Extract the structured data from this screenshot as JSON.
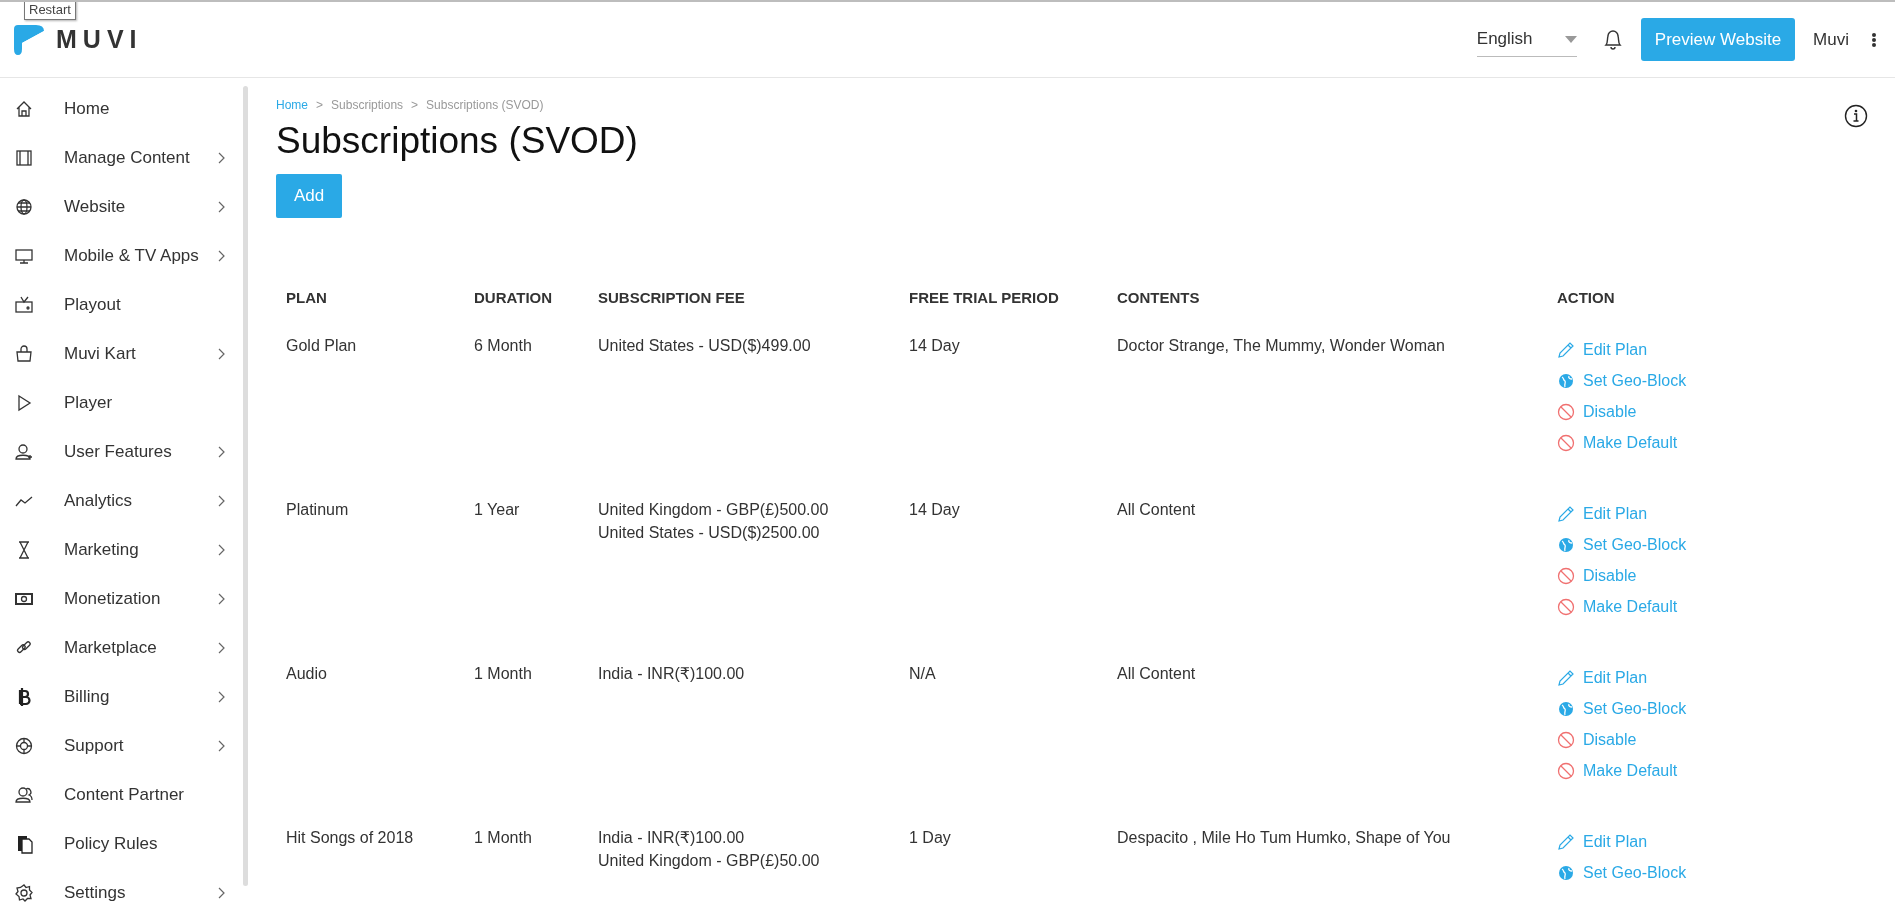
{
  "tooltip": "Restart",
  "logo": {
    "text": "MUVI"
  },
  "header": {
    "language": {
      "value": "English"
    },
    "preview_button": "Preview Website",
    "user": "Muvi"
  },
  "sidebar": {
    "items": [
      {
        "label": "Home",
        "expandable": false
      },
      {
        "label": "Manage Content",
        "expandable": true
      },
      {
        "label": "Website",
        "expandable": true
      },
      {
        "label": "Mobile & TV Apps",
        "expandable": true
      },
      {
        "label": "Playout",
        "expandable": false
      },
      {
        "label": "Muvi Kart",
        "expandable": true
      },
      {
        "label": "Player",
        "expandable": false
      },
      {
        "label": "User Features",
        "expandable": true
      },
      {
        "label": "Analytics",
        "expandable": true
      },
      {
        "label": "Marketing",
        "expandable": true
      },
      {
        "label": "Monetization",
        "expandable": true
      },
      {
        "label": "Marketplace",
        "expandable": true
      },
      {
        "label": "Billing",
        "expandable": true
      },
      {
        "label": "Support",
        "expandable": true
      },
      {
        "label": "Content Partner",
        "expandable": false
      },
      {
        "label": "Policy Rules",
        "expandable": false
      },
      {
        "label": "Settings",
        "expandable": true
      }
    ]
  },
  "breadcrumb": [
    {
      "label": "Home",
      "link": true
    },
    {
      "label": "Subscriptions",
      "link": false
    },
    {
      "label": "Subscriptions (SVOD)",
      "link": false
    }
  ],
  "breadcrumb_separator": ">",
  "page_title": "Subscriptions (SVOD)",
  "add_button": "Add",
  "table": {
    "columns": [
      "PLAN",
      "DURATION",
      "SUBSCRIPTION FEE",
      "FREE TRIAL PERIOD",
      "CONTENTS",
      "ACTION"
    ],
    "rows": [
      {
        "plan": "Gold Plan",
        "duration": "6 Month",
        "fees": [
          "United States - USD($)499.00"
        ],
        "trial": "14 Day",
        "contents": "Doctor Strange, The Mummy, Wonder Woman",
        "actions": [
          {
            "kind": "edit",
            "label": "Edit Plan"
          },
          {
            "kind": "geoblock",
            "label": "Set Geo-Block"
          },
          {
            "kind": "disable",
            "label": "Disable"
          },
          {
            "kind": "default",
            "label": "Make Default"
          }
        ]
      },
      {
        "plan": "Platinum",
        "duration": "1 Year",
        "fees": [
          "United Kingdom - GBP(£)500.00",
          "United States - USD($)2500.00"
        ],
        "trial": "14 Day",
        "contents": "All Content",
        "actions": [
          {
            "kind": "edit",
            "label": "Edit Plan"
          },
          {
            "kind": "geoblock",
            "label": "Set Geo-Block"
          },
          {
            "kind": "disable",
            "label": "Disable"
          },
          {
            "kind": "default",
            "label": "Make Default"
          }
        ]
      },
      {
        "plan": "Audio",
        "duration": "1 Month",
        "fees": [
          "India - INR(₹)100.00"
        ],
        "trial": "N/A",
        "contents": "All Content",
        "actions": [
          {
            "kind": "edit",
            "label": "Edit Plan"
          },
          {
            "kind": "geoblock",
            "label": "Set Geo-Block"
          },
          {
            "kind": "disable",
            "label": "Disable"
          },
          {
            "kind": "default",
            "label": "Make Default"
          }
        ]
      },
      {
        "plan": "Hit Songs of 2018",
        "duration": "1 Month",
        "fees": [
          "India - INR(₹)100.00",
          "United Kingdom - GBP(£)50.00"
        ],
        "trial": "1 Day",
        "contents": "Despacito , Mile Ho Tum Humko, Shape of You",
        "actions": [
          {
            "kind": "edit",
            "label": "Edit Plan"
          },
          {
            "kind": "geoblock",
            "label": "Set Geo-Block"
          }
        ]
      }
    ]
  }
}
